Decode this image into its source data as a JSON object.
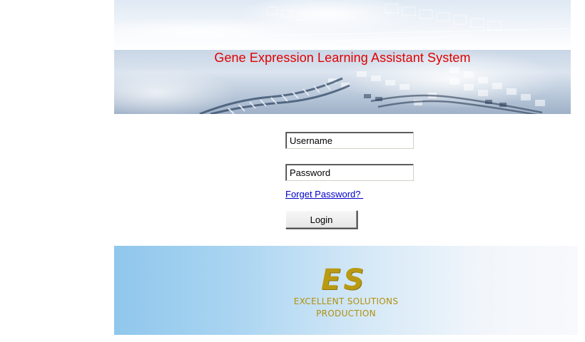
{
  "banner": {
    "title": "Gene Expression Learning Assistant System",
    "title_color": "#e00000"
  },
  "login": {
    "username_value": "Username",
    "password_value": "Password",
    "forget_password_label": "Forget Password? ",
    "login_button_label": "Login",
    "link_color": "#0000cc"
  },
  "footer": {
    "logo_mark": "ES",
    "logo_line1": "EXCELLENT SOLUTIONS",
    "logo_line2": "PRODUCTION",
    "logo_color": "#b99a12"
  }
}
